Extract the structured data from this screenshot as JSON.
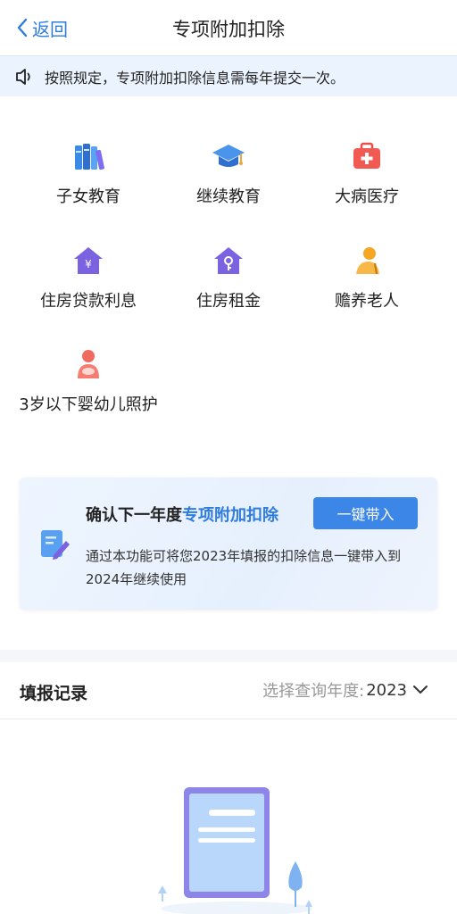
{
  "nav": {
    "back_label": "返回",
    "title": "专项附加扣除"
  },
  "notice": {
    "icon": "speaker-icon",
    "text": "按照规定，专项附加扣除信息需每年提交一次。"
  },
  "categories": [
    {
      "label": "子女教育",
      "icon": "books-icon"
    },
    {
      "label": "继续教育",
      "icon": "graduation-cap-icon"
    },
    {
      "label": "大病医疗",
      "icon": "medical-kit-icon"
    },
    {
      "label": "住房贷款利息",
      "icon": "house-yuan-icon"
    },
    {
      "label": "住房租金",
      "icon": "house-key-icon"
    },
    {
      "label": "赡养老人",
      "icon": "elderly-person-icon"
    },
    {
      "label": "3岁以下婴幼儿照护",
      "icon": "mother-baby-icon"
    }
  ],
  "promo": {
    "title_prefix": "确认下一年度",
    "title_highlight": "专项附加扣除",
    "button_label": "一键带入",
    "description": "通过本功能可将您2023年填报的扣除信息一键带入到2024年继续使用",
    "icon": "form-pen-icon"
  },
  "records": {
    "title": "填报记录",
    "year_label": "选择查询年度:",
    "year_value": "2023"
  },
  "colors": {
    "accent": "#2f7ce0",
    "button": "#3b86e6",
    "notice_bg": "#eaf3fe"
  }
}
